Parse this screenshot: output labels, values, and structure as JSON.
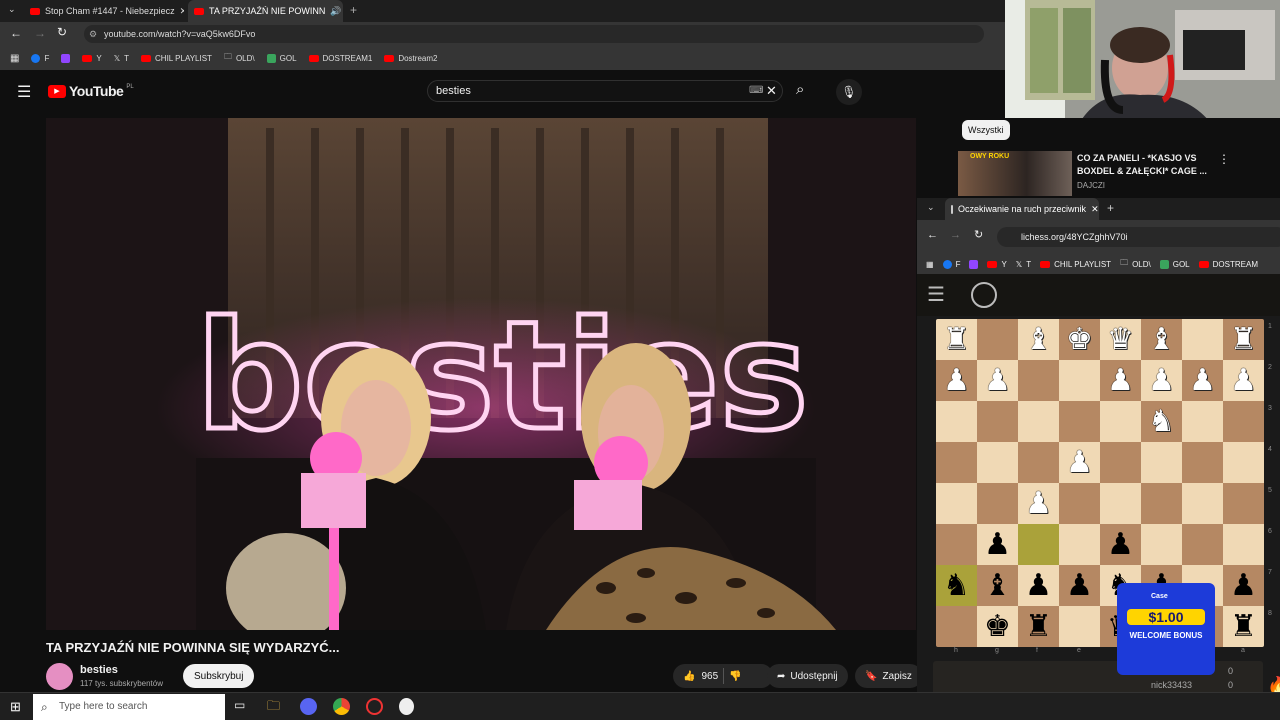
{
  "browser": {
    "tabs": [
      {
        "label": "Stop Cham #1447 - Niebezpiecz"
      },
      {
        "label": "TA PRZYJAŹŃ NIE POWINN"
      }
    ],
    "url": "youtube.com/watch?v=vaQ5kw6DFvo",
    "bookmarks": [
      "F",
      "Y",
      "T",
      "CHIL PLAYLIST",
      "OLD\\",
      "GOL",
      "DOSTREAM1",
      "Dostream2"
    ]
  },
  "youtube": {
    "logo": "YouTube",
    "region": "PL",
    "search_value": "besties",
    "video_title": "TA PRZYJAŹŃ NIE POWINNA SIĘ WYDARZYĆ...",
    "neon_text": "besties",
    "channel_name": "besties",
    "subscribers": "117 tys. subskrybentów",
    "subscribe_label": "Subskrybuj",
    "like_count": "965",
    "share_label": "Udostępnij",
    "save_label": "Zapisz",
    "chip_label": "Wszystki",
    "suggested": {
      "title_line1": "CO ZA PANELI - *KASJO VS",
      "title_line2": "BOXDEL & ZAŁĘCKI* CAGE ...",
      "channel": "DAJCZI",
      "thumb_text": "OWY ROKU"
    }
  },
  "lichess": {
    "tab_label": "Oczekiwanie na ruch przeciwnik",
    "url": "lichess.org/48YCZghhV70i",
    "bookmarks": [
      "F",
      "Y",
      "T",
      "CHIL PLAYLIST",
      "OLD\\",
      "GOL",
      "DOSTREAM"
    ],
    "files": [
      "h",
      "g",
      "f",
      "e",
      "d",
      "c",
      "b",
      "a"
    ],
    "ranks": [
      "1",
      "2",
      "3",
      "4",
      "5",
      "6",
      "7",
      "8"
    ],
    "player": "nick33433",
    "scores": [
      "0",
      "0"
    ],
    "ad": {
      "brand": "Case",
      "amount": "$1.00",
      "text": "WELCOME BONUS"
    },
    "board": [
      [
        "wR",
        "",
        "wB",
        "wK",
        "wQ",
        "wB",
        "",
        "wR"
      ],
      [
        "wP",
        "wP",
        "",
        "",
        "wP",
        "wP",
        "wP",
        "wP"
      ],
      [
        "",
        "",
        "",
        "",
        "",
        "wN",
        "",
        ""
      ],
      [
        "",
        "",
        "",
        "wP",
        "",
        "",
        "",
        ""
      ],
      [
        "",
        "",
        "wP",
        "",
        "",
        "",
        "",
        ""
      ],
      [
        "",
        "bP",
        "",
        "",
        "bP",
        "",
        "",
        ""
      ],
      [
        "bN",
        "bB",
        "bP",
        "bP",
        "bN",
        "bP",
        "",
        "bP"
      ],
      [
        "",
        "bK",
        "bR",
        "",
        "bQ",
        "",
        "",
        "bR"
      ]
    ]
  },
  "taskbar": {
    "search_placeholder": "Type here to search"
  },
  "colors": {
    "light_square": "#f0d9b5",
    "dark_square": "#b58863",
    "highlight": "#aaa23a",
    "yt_red": "#ff0000",
    "neon_pink": "#ff4fbf"
  }
}
